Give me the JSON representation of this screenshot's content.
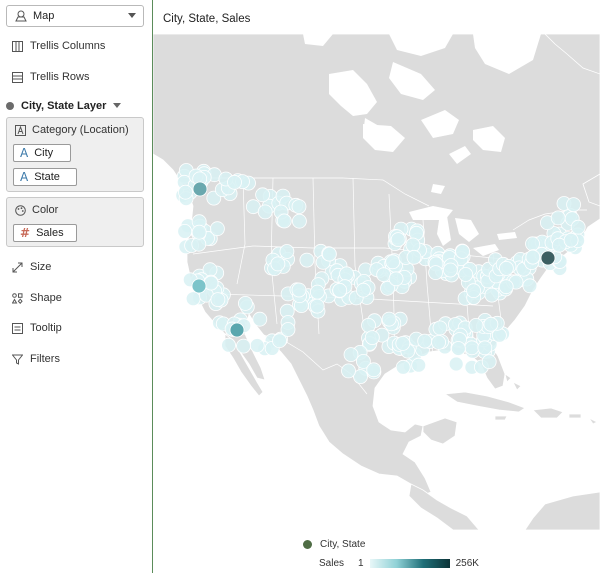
{
  "grammar_panel": {
    "vis_type": {
      "label": "Map",
      "icon": "map-pin-icon"
    },
    "trellis_columns": "Trellis Columns",
    "trellis_rows": "Trellis Rows",
    "layer": {
      "label": "City, State Layer"
    },
    "category": {
      "label": "Category (Location)",
      "items": [
        {
          "label": "City"
        },
        {
          "label": "State"
        }
      ]
    },
    "color": {
      "label": "Color",
      "items": [
        {
          "label": "Sales"
        }
      ]
    },
    "size": "Size",
    "shape": "Shape",
    "tooltip": "Tooltip",
    "filters": "Filters"
  },
  "canvas": {
    "title": "City, State, Sales",
    "legend": {
      "series_label": "City, State",
      "color_label": "Sales",
      "min": "1",
      "max": "256K"
    }
  },
  "colors": {
    "land": "#dcdcdc",
    "water": "#ffffff",
    "bubble_light": "#d8f1f3",
    "bubble_dark": "#0b3337",
    "series_dot": "#4f6d45"
  }
}
